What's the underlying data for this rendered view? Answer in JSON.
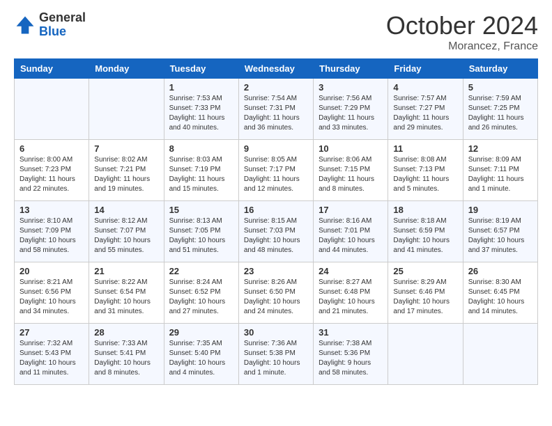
{
  "header": {
    "logo_general": "General",
    "logo_blue": "Blue",
    "month_title": "October 2024",
    "subtitle": "Morancez, France"
  },
  "weekdays": [
    "Sunday",
    "Monday",
    "Tuesday",
    "Wednesday",
    "Thursday",
    "Friday",
    "Saturday"
  ],
  "weeks": [
    [
      {
        "day": "",
        "sunrise": "",
        "sunset": "",
        "daylight": ""
      },
      {
        "day": "",
        "sunrise": "",
        "sunset": "",
        "daylight": ""
      },
      {
        "day": "1",
        "sunrise": "Sunrise: 7:53 AM",
        "sunset": "Sunset: 7:33 PM",
        "daylight": "Daylight: 11 hours and 40 minutes."
      },
      {
        "day": "2",
        "sunrise": "Sunrise: 7:54 AM",
        "sunset": "Sunset: 7:31 PM",
        "daylight": "Daylight: 11 hours and 36 minutes."
      },
      {
        "day": "3",
        "sunrise": "Sunrise: 7:56 AM",
        "sunset": "Sunset: 7:29 PM",
        "daylight": "Daylight: 11 hours and 33 minutes."
      },
      {
        "day": "4",
        "sunrise": "Sunrise: 7:57 AM",
        "sunset": "Sunset: 7:27 PM",
        "daylight": "Daylight: 11 hours and 29 minutes."
      },
      {
        "day": "5",
        "sunrise": "Sunrise: 7:59 AM",
        "sunset": "Sunset: 7:25 PM",
        "daylight": "Daylight: 11 hours and 26 minutes."
      }
    ],
    [
      {
        "day": "6",
        "sunrise": "Sunrise: 8:00 AM",
        "sunset": "Sunset: 7:23 PM",
        "daylight": "Daylight: 11 hours and 22 minutes."
      },
      {
        "day": "7",
        "sunrise": "Sunrise: 8:02 AM",
        "sunset": "Sunset: 7:21 PM",
        "daylight": "Daylight: 11 hours and 19 minutes."
      },
      {
        "day": "8",
        "sunrise": "Sunrise: 8:03 AM",
        "sunset": "Sunset: 7:19 PM",
        "daylight": "Daylight: 11 hours and 15 minutes."
      },
      {
        "day": "9",
        "sunrise": "Sunrise: 8:05 AM",
        "sunset": "Sunset: 7:17 PM",
        "daylight": "Daylight: 11 hours and 12 minutes."
      },
      {
        "day": "10",
        "sunrise": "Sunrise: 8:06 AM",
        "sunset": "Sunset: 7:15 PM",
        "daylight": "Daylight: 11 hours and 8 minutes."
      },
      {
        "day": "11",
        "sunrise": "Sunrise: 8:08 AM",
        "sunset": "Sunset: 7:13 PM",
        "daylight": "Daylight: 11 hours and 5 minutes."
      },
      {
        "day": "12",
        "sunrise": "Sunrise: 8:09 AM",
        "sunset": "Sunset: 7:11 PM",
        "daylight": "Daylight: 11 hours and 1 minute."
      }
    ],
    [
      {
        "day": "13",
        "sunrise": "Sunrise: 8:10 AM",
        "sunset": "Sunset: 7:09 PM",
        "daylight": "Daylight: 10 hours and 58 minutes."
      },
      {
        "day": "14",
        "sunrise": "Sunrise: 8:12 AM",
        "sunset": "Sunset: 7:07 PM",
        "daylight": "Daylight: 10 hours and 55 minutes."
      },
      {
        "day": "15",
        "sunrise": "Sunrise: 8:13 AM",
        "sunset": "Sunset: 7:05 PM",
        "daylight": "Daylight: 10 hours and 51 minutes."
      },
      {
        "day": "16",
        "sunrise": "Sunrise: 8:15 AM",
        "sunset": "Sunset: 7:03 PM",
        "daylight": "Daylight: 10 hours and 48 minutes."
      },
      {
        "day": "17",
        "sunrise": "Sunrise: 8:16 AM",
        "sunset": "Sunset: 7:01 PM",
        "daylight": "Daylight: 10 hours and 44 minutes."
      },
      {
        "day": "18",
        "sunrise": "Sunrise: 8:18 AM",
        "sunset": "Sunset: 6:59 PM",
        "daylight": "Daylight: 10 hours and 41 minutes."
      },
      {
        "day": "19",
        "sunrise": "Sunrise: 8:19 AM",
        "sunset": "Sunset: 6:57 PM",
        "daylight": "Daylight: 10 hours and 37 minutes."
      }
    ],
    [
      {
        "day": "20",
        "sunrise": "Sunrise: 8:21 AM",
        "sunset": "Sunset: 6:56 PM",
        "daylight": "Daylight: 10 hours and 34 minutes."
      },
      {
        "day": "21",
        "sunrise": "Sunrise: 8:22 AM",
        "sunset": "Sunset: 6:54 PM",
        "daylight": "Daylight: 10 hours and 31 minutes."
      },
      {
        "day": "22",
        "sunrise": "Sunrise: 8:24 AM",
        "sunset": "Sunset: 6:52 PM",
        "daylight": "Daylight: 10 hours and 27 minutes."
      },
      {
        "day": "23",
        "sunrise": "Sunrise: 8:26 AM",
        "sunset": "Sunset: 6:50 PM",
        "daylight": "Daylight: 10 hours and 24 minutes."
      },
      {
        "day": "24",
        "sunrise": "Sunrise: 8:27 AM",
        "sunset": "Sunset: 6:48 PM",
        "daylight": "Daylight: 10 hours and 21 minutes."
      },
      {
        "day": "25",
        "sunrise": "Sunrise: 8:29 AM",
        "sunset": "Sunset: 6:46 PM",
        "daylight": "Daylight: 10 hours and 17 minutes."
      },
      {
        "day": "26",
        "sunrise": "Sunrise: 8:30 AM",
        "sunset": "Sunset: 6:45 PM",
        "daylight": "Daylight: 10 hours and 14 minutes."
      }
    ],
    [
      {
        "day": "27",
        "sunrise": "Sunrise: 7:32 AM",
        "sunset": "Sunset: 5:43 PM",
        "daylight": "Daylight: 10 hours and 11 minutes."
      },
      {
        "day": "28",
        "sunrise": "Sunrise: 7:33 AM",
        "sunset": "Sunset: 5:41 PM",
        "daylight": "Daylight: 10 hours and 8 minutes."
      },
      {
        "day": "29",
        "sunrise": "Sunrise: 7:35 AM",
        "sunset": "Sunset: 5:40 PM",
        "daylight": "Daylight: 10 hours and 4 minutes."
      },
      {
        "day": "30",
        "sunrise": "Sunrise: 7:36 AM",
        "sunset": "Sunset: 5:38 PM",
        "daylight": "Daylight: 10 hours and 1 minute."
      },
      {
        "day": "31",
        "sunrise": "Sunrise: 7:38 AM",
        "sunset": "Sunset: 5:36 PM",
        "daylight": "Daylight: 9 hours and 58 minutes."
      },
      {
        "day": "",
        "sunrise": "",
        "sunset": "",
        "daylight": ""
      },
      {
        "day": "",
        "sunrise": "",
        "sunset": "",
        "daylight": ""
      }
    ]
  ]
}
